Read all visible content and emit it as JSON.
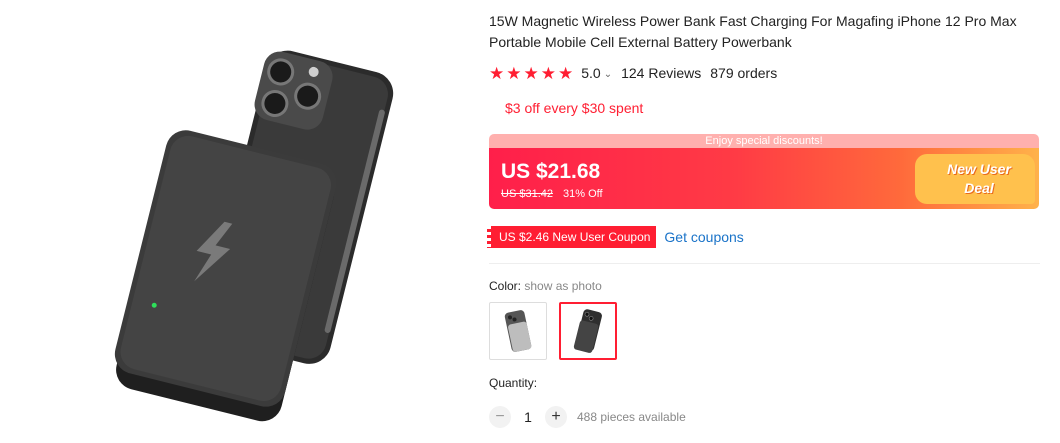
{
  "product": {
    "title": "15W Magnetic Wireless Power Bank Fast Charging For Magafing iPhone 12 Pro Max Portable Mobile Cell External Battery Powerbank",
    "image_name": "black-magnetic-power-bank-on-phone"
  },
  "rating": {
    "value": "5.0",
    "stars": 5,
    "chevron": "⌄",
    "reviews": "124 Reviews",
    "orders": "879 orders"
  },
  "promo": {
    "text": "$3 off every $30 spent"
  },
  "price_banner": {
    "top_text": "Enjoy special discounts!",
    "price": "US $21.68",
    "original_price": "US $31.42",
    "discount": "31% Off",
    "deal_line1": "New User",
    "deal_line2": "Deal"
  },
  "coupon": {
    "tag": "US $2.46 New User Coupon",
    "link": "Get coupons"
  },
  "color": {
    "label": "Color:",
    "hint": "show as photo",
    "options": [
      "silver-gray",
      "black"
    ],
    "selected_index": 1
  },
  "quantity": {
    "label": "Quantity:",
    "minus": "−",
    "value": "1",
    "plus": "+",
    "available": "488 pieces available"
  },
  "colors": {
    "accent_red": "#ff1e32",
    "link_blue": "#1a73c8"
  }
}
